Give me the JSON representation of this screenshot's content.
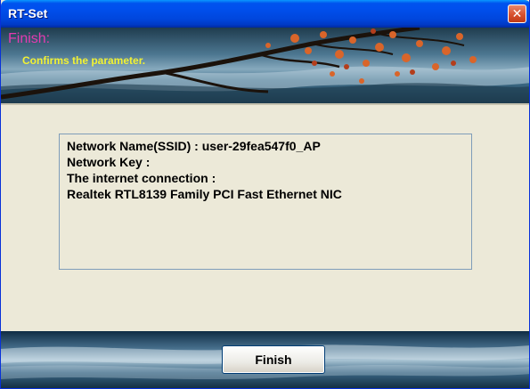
{
  "window": {
    "title": "RT-Set",
    "close_icon": "close-icon"
  },
  "banner": {
    "title": "Finish:",
    "subtitle": "Confirms the parameter."
  },
  "info": {
    "lines": [
      "Network Name(SSID) : user-29fea547f0_AP",
      "Network Key :",
      "The internet connection :",
      "Realtek RTL8139 Family PCI Fast Ethernet NIC"
    ]
  },
  "footer": {
    "finish_label": "Finish"
  },
  "colors": {
    "titlebar": "#0050ee",
    "banner_title": "#e43bb0",
    "banner_subtitle": "#f2f233",
    "panel": "#ece9d8"
  }
}
